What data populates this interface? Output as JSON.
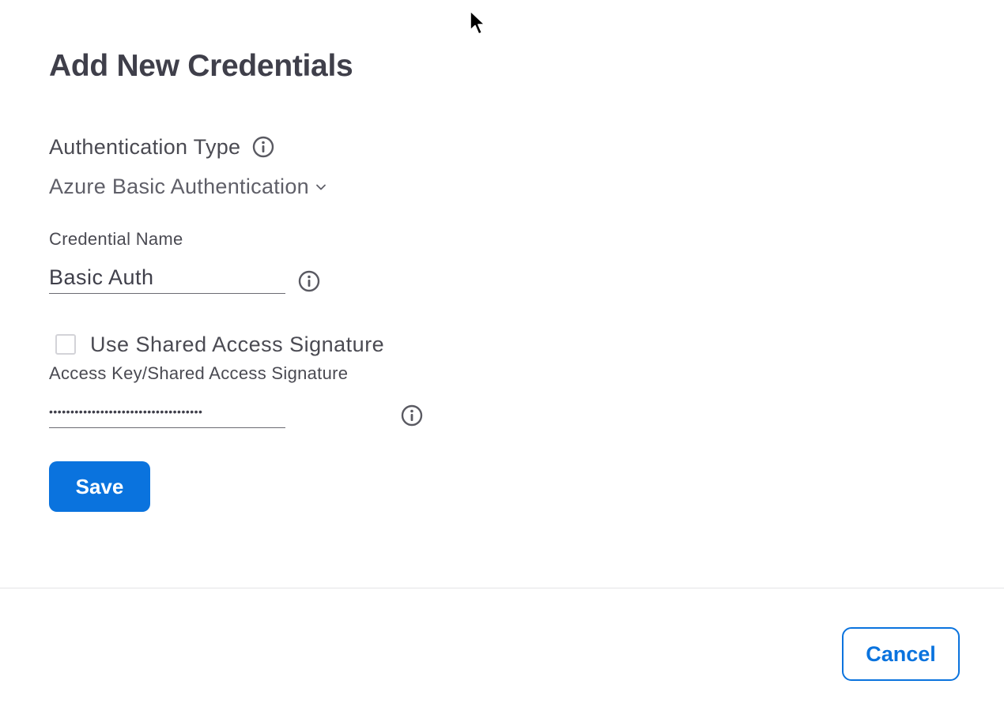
{
  "dialog": {
    "title": "Add New Credentials"
  },
  "auth_type": {
    "label": "Authentication Type",
    "info_icon": "info-icon",
    "selected_value": "Azure Basic Authentication",
    "dropdown_icon": "chevron-down-icon"
  },
  "credential_name": {
    "label": "Credential Name",
    "value": "Basic Auth",
    "info_icon": "info-icon"
  },
  "shared_access_signature": {
    "label": "Use Shared Access Signature",
    "checked": false
  },
  "access_key": {
    "label": "Access Key/Shared Access Signature",
    "value": "••••••••••••••••••••••••••••••••••••",
    "info_icon": "info-icon"
  },
  "buttons": {
    "save_label": "Save",
    "cancel_label": "Cancel"
  },
  "colors": {
    "accent": "#0a73de",
    "title_text": "#3f3f4a",
    "body_text": "#4a4a52",
    "divider": "#e3e3e6"
  }
}
